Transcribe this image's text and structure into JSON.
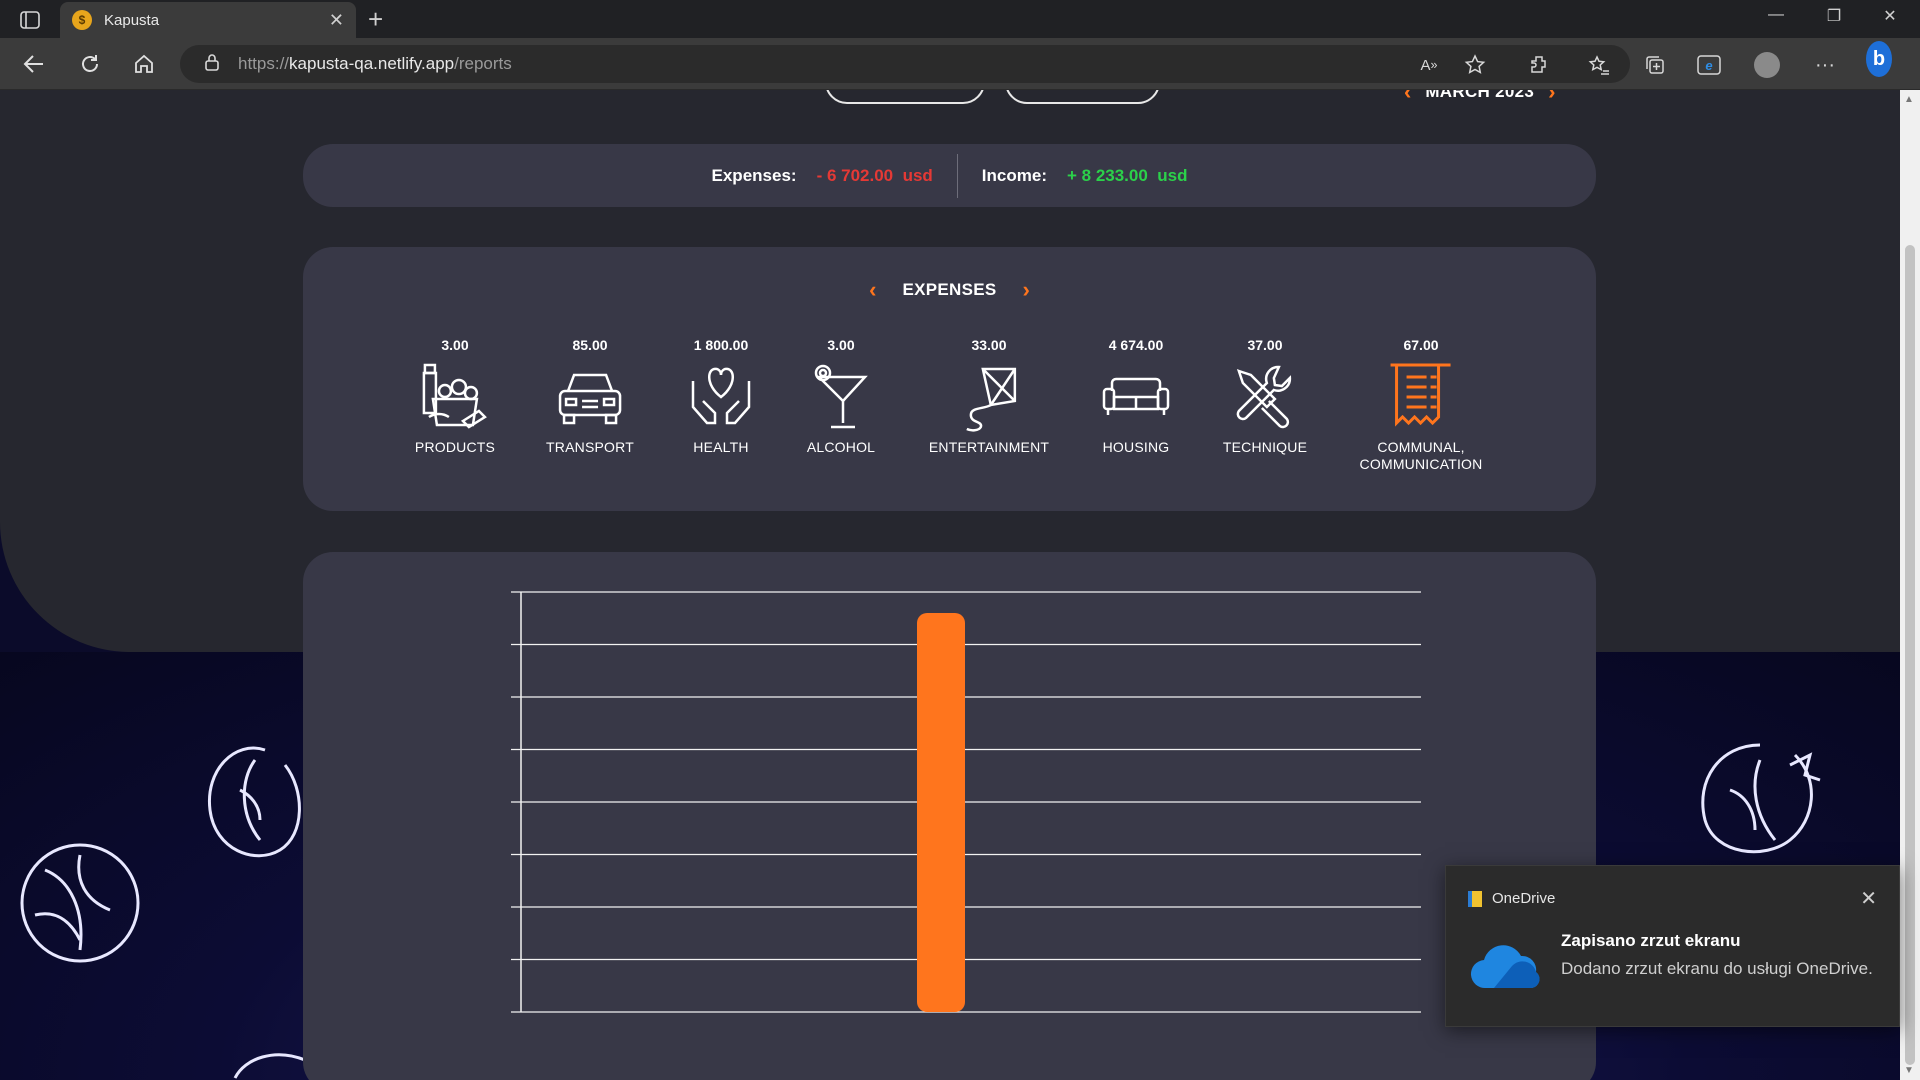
{
  "browser": {
    "tab_title": "Kapusta",
    "tab_favicon": "$",
    "url_scheme": "https://",
    "url_host": "kapusta-qa.netlify.app",
    "url_path": "/reports"
  },
  "period": {
    "label": "MARCH 2023"
  },
  "summary": {
    "expenses_label": "Expenses:",
    "expenses_value": "- 6 702.00  usd",
    "income_label": "Income:",
    "income_value": "+ 8 233.00  usd",
    "expense_color": "#e53935",
    "income_color": "#2bd14a"
  },
  "categories": {
    "title": "EXPENSES",
    "accent": "#ff751d",
    "items": [
      {
        "value": "3.00",
        "name": "PRODUCTS",
        "icon": "products-icon"
      },
      {
        "value": "85.00",
        "name": "TRANSPORT",
        "icon": "car-icon"
      },
      {
        "value": "1 800.00",
        "name": "HEALTH",
        "icon": "hands-heart-icon"
      },
      {
        "value": "3.00",
        "name": "ALCOHOL",
        "icon": "cocktail-icon"
      },
      {
        "value": "33.00",
        "name": "ENTERTAINMENT",
        "icon": "kite-icon"
      },
      {
        "value": "4 674.00",
        "name": "HOUSING",
        "icon": "sofa-icon"
      },
      {
        "value": "37.00",
        "name": "TECHNIQUE",
        "icon": "tools-icon"
      },
      {
        "value": "67.00",
        "name": "COMMUNAL,",
        "name2": "COMMUNICATION",
        "icon": "receipt-icon",
        "active": true
      }
    ]
  },
  "chart_data": {
    "type": "bar",
    "categories": [
      ""
    ],
    "values": [
      7.6
    ],
    "ylim": [
      0,
      8
    ],
    "grid": true,
    "bar_color": "#ff751d"
  },
  "toast": {
    "app_name": "OneDrive",
    "title": "Zapisano zrzut ekranu",
    "message": "Dodano zrzut ekranu do usługi OneDrive."
  }
}
